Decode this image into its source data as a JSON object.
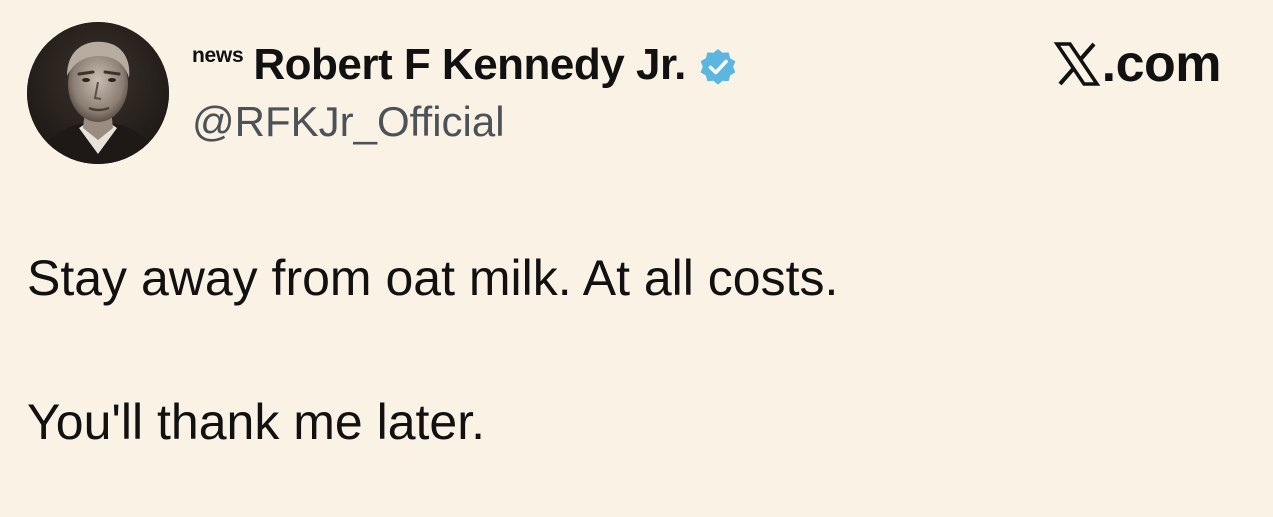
{
  "author": {
    "news_label": "news",
    "display_name": "Robert F Kennedy Jr.",
    "handle": "@RFKJr_Official",
    "verified": true,
    "verified_color": "#5bb7df"
  },
  "platform": {
    "logo_text": ".com",
    "logo_icon": "x-logo-icon"
  },
  "tweet": {
    "lines": [
      "Stay away from oat milk. At all costs.",
      "You'll thank me later."
    ]
  },
  "colors": {
    "background": "#fbf2e6",
    "text": "#111111",
    "handle": "#4b5258"
  }
}
